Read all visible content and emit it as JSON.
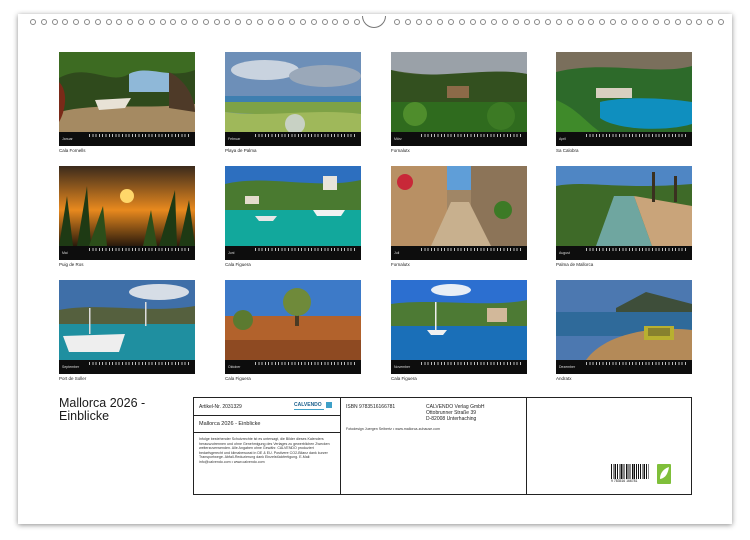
{
  "calendar_title": "Mallorca 2026 - Einblicke",
  "months": [
    {
      "month": "Januar",
      "caption": "Cala Fornells"
    },
    {
      "month": "Februar",
      "caption": "Playa de Palma"
    },
    {
      "month": "März",
      "caption": "Fornalutx"
    },
    {
      "month": "April",
      "caption": "Sa Calobra"
    },
    {
      "month": "Mai",
      "caption": "Puig de Ros"
    },
    {
      "month": "Juni",
      "caption": "Cala Figuera"
    },
    {
      "month": "Juli",
      "caption": "Fornalutx"
    },
    {
      "month": "August",
      "caption": "Palma de Mallorca"
    },
    {
      "month": "September",
      "caption": "Port de Soller"
    },
    {
      "month": "Oktober",
      "caption": "Cala Figuera"
    },
    {
      "month": "November",
      "caption": "Cala Figuera"
    },
    {
      "month": "Dezember",
      "caption": "Andratx"
    }
  ],
  "info": {
    "article": "Artikel-Nr. 2031329",
    "brand": "CALVENDO",
    "title": "Mallorca 2026 - Einblicke",
    "legal_text": "Infolge bestehender Schutzrechte ist es untersagt, die Bilder dieses Kalenders herauszutrennen und ohne Genehmigung des Verlages zu gewerblichen Zwecken weiterzuverwenden. Alle Angaben ohne Gewähr. CALVENDO produziert bedarfsgerecht und klimabewusst in DE & EU. Postivere CO2-Bilanz dank kurzer Transportwege. Abfall-Reduzierung dank Einzelstückfertigung. E-Mail: info@calvendo.com • www.calvendo.com",
    "isbn": "ISBN 9783516166781",
    "publisher_name": "CALVENDO Verlag GmbH",
    "publisher_street": "Ottobrunner Straße 39",
    "publisher_city": "D-82008 Unterhaching",
    "photo_credit": "Fotodesign Juergen Seibertz • www.mallorca-zuhause.com",
    "barcode_number": "9 783516 166781"
  }
}
